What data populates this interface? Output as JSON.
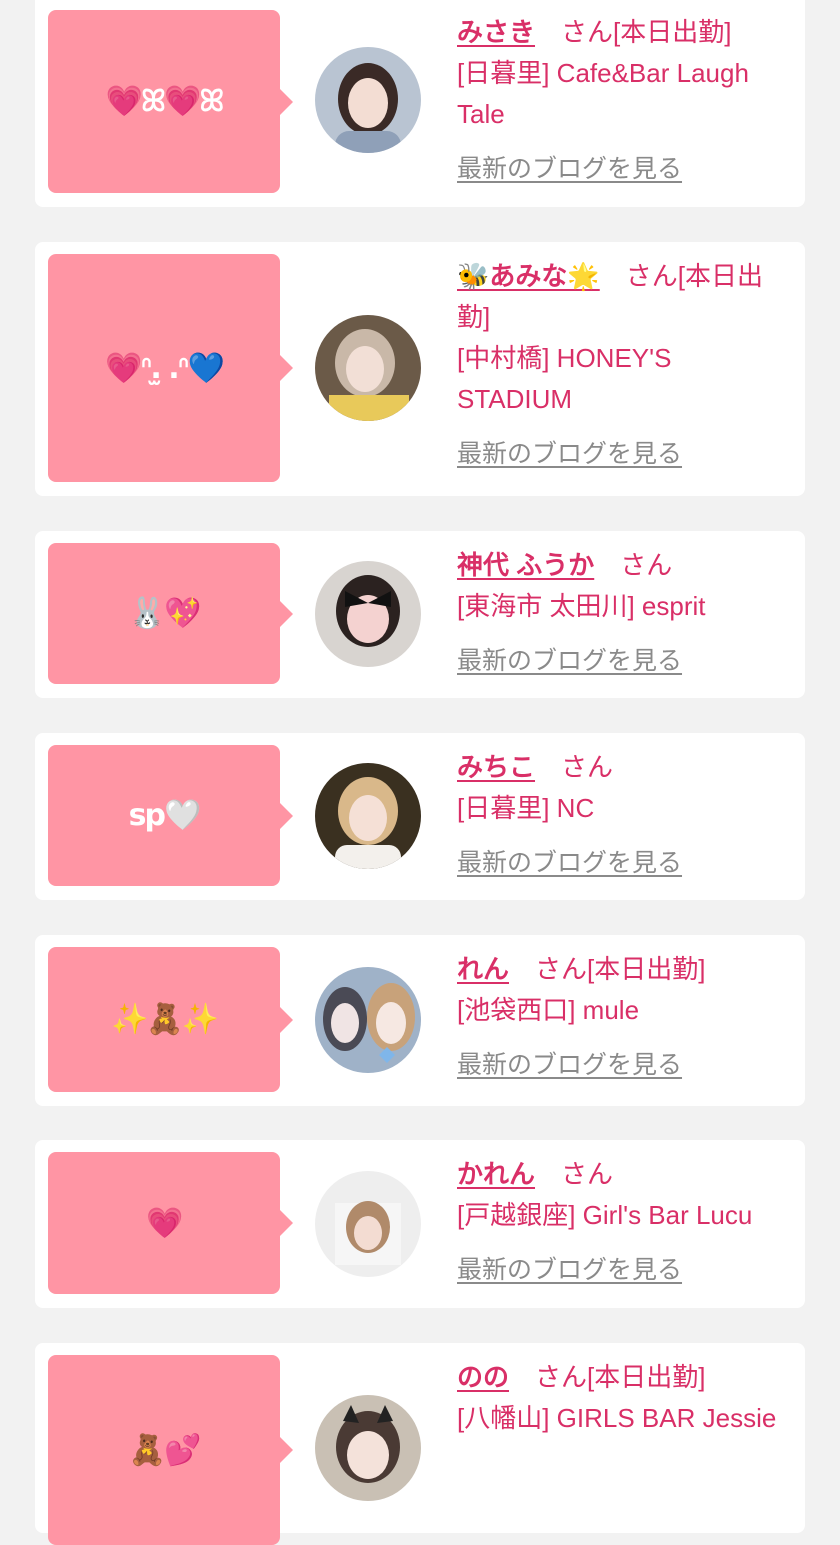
{
  "suffix": "さん",
  "blog_link": "最新のブログを見る",
  "cards": [
    {
      "bubble": "💗ꕤ💗ꕤ",
      "name": "みさき",
      "status": "[本日出勤]",
      "shop": "[日暮里] Cafe&Bar Laugh Tale"
    },
    {
      "bubble": "💗ᐢ.̫ .ᐢ💙",
      "name": "🐝あみな🌟",
      "status": "[本日出勤]",
      "shop": "[中村橋] HONEY'S STADIUM"
    },
    {
      "bubble": "🐰💖",
      "name": "神代 ふうか",
      "status": "",
      "shop": "[東海市 太田川] esprit"
    },
    {
      "bubble": "sp🤍",
      "name": "みちこ",
      "status": "",
      "shop": "[日暮里] NC"
    },
    {
      "bubble": "✨🧸✨",
      "name": "れん",
      "status": "[本日出勤]",
      "shop": "[池袋西口] mule"
    },
    {
      "bubble": "💗",
      "name": "かれん",
      "status": "",
      "shop": "[戸越銀座] Girl's Bar Lucu"
    },
    {
      "bubble": "🧸💕",
      "name": "のの",
      "status": "[本日出勤]",
      "shop": "[八幡山] GIRLS BAR Jessie"
    }
  ]
}
